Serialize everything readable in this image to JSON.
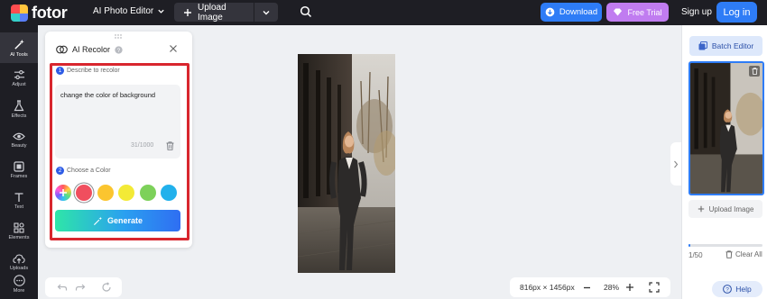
{
  "brand": {
    "name": "fotor",
    "logo_colors": [
      "#ff4d4f",
      "#ffc53d",
      "#36cfc9",
      "#597ef7"
    ]
  },
  "topbar": {
    "editor_menu": "AI Photo Editor",
    "upload_label": "Upload Image",
    "download_label": "Download",
    "trial_label": "Free Trial",
    "signup_label": "Sign up",
    "login_label": "Log in"
  },
  "rail": {
    "items": [
      {
        "label": "AI Tools",
        "icon": "wand-icon"
      },
      {
        "label": "Adjust",
        "icon": "sliders-icon"
      },
      {
        "label": "Effects",
        "icon": "flask-icon"
      },
      {
        "label": "Beauty",
        "icon": "eye-icon"
      },
      {
        "label": "Frames",
        "icon": "frame-icon"
      },
      {
        "label": "Text",
        "icon": "text-icon"
      },
      {
        "label": "Elements",
        "icon": "shapes-icon"
      },
      {
        "label": "Uploads",
        "icon": "cloud-upload-icon"
      },
      {
        "label": "More",
        "icon": "more-icon"
      }
    ]
  },
  "recolor": {
    "title": "AI Recolor",
    "step1_num": "1",
    "step1_label": "Describe to recolor",
    "prompt_value": "change the color of background",
    "counter": "31/1000",
    "step2_num": "2",
    "step2_label": "Choose a Color",
    "swatches": [
      {
        "name": "custom",
        "color": "rainbow"
      },
      {
        "name": "red",
        "color": "#f04e5e",
        "selected": true
      },
      {
        "name": "amber",
        "color": "#fbc52f"
      },
      {
        "name": "yellow",
        "color": "#f3ea36"
      },
      {
        "name": "green",
        "color": "#7dd15a"
      },
      {
        "name": "sky",
        "color": "#22b1ec"
      }
    ],
    "generate_label": "Generate",
    "highlight_color": "#d8262e"
  },
  "canvas_bar": {
    "dimensions": "816px × 1456px",
    "zoom": "28%"
  },
  "right_panel": {
    "batch_label": "Batch Editor",
    "upload_label": "Upload Image",
    "count": "1/50",
    "progress": 0.02,
    "clear_label": "Clear All",
    "help_label": "Help"
  },
  "colors": {
    "accent": "#2e7cf6",
    "dark_bg": "#1e1e24",
    "trial": "#c07cf0"
  }
}
